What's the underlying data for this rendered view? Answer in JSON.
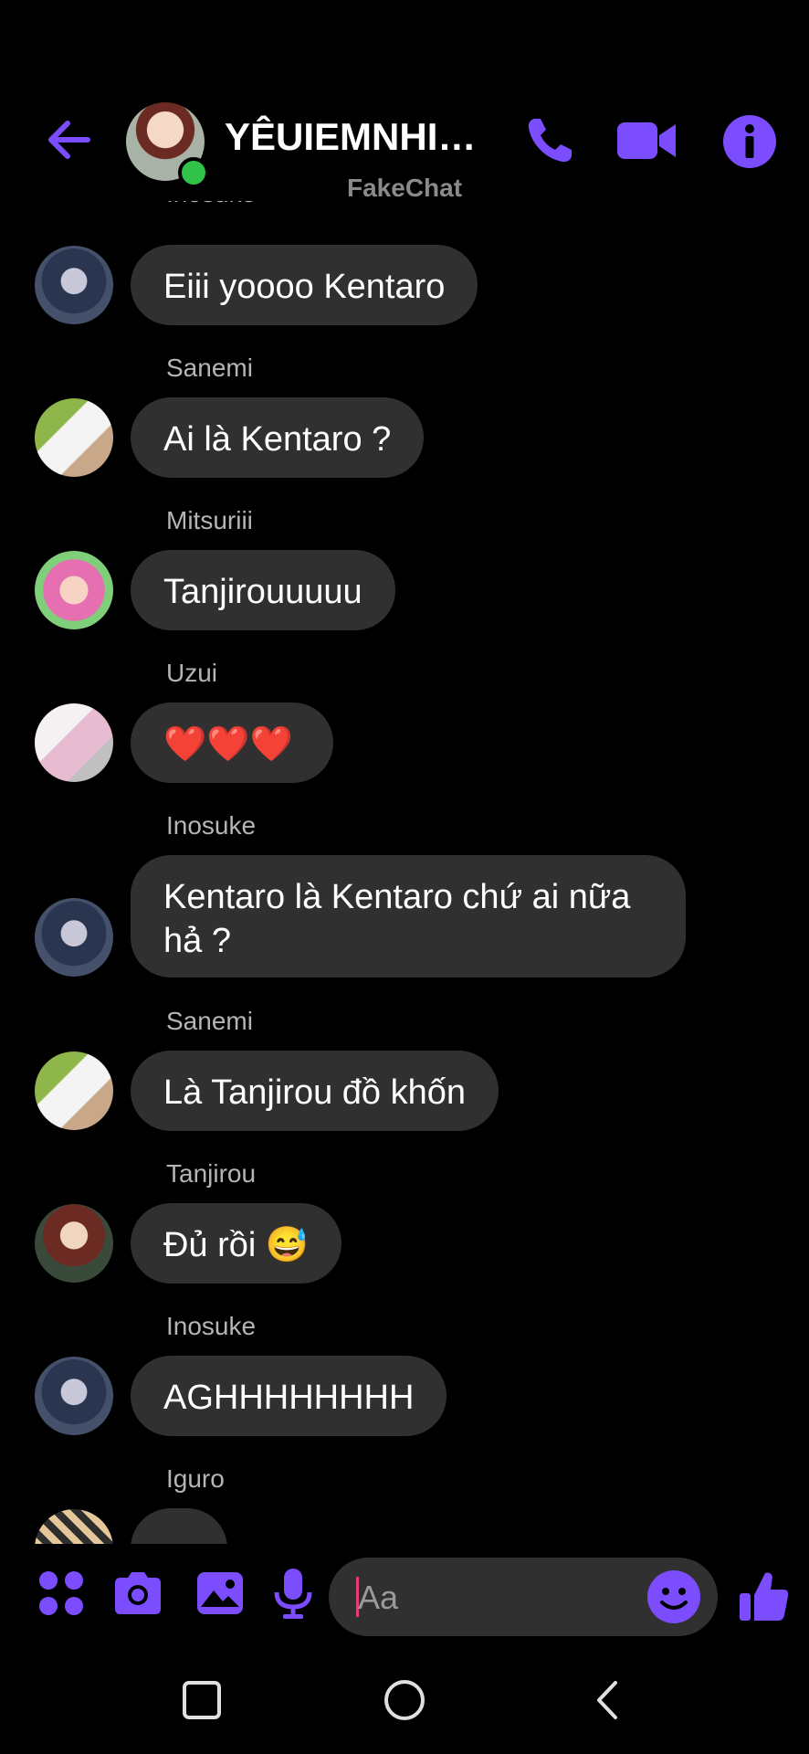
{
  "header": {
    "title": "YÊUIEMNHIEU...",
    "watermark": "FakeChat"
  },
  "messages": [
    {
      "sender": "Inosuke",
      "text": "Eiii yoooo Kentaro",
      "avatar": "inosuke-avatar"
    },
    {
      "sender": "Sanemi",
      "text": "Ai là Kentaro ?",
      "avatar": "sanemi-avatar"
    },
    {
      "sender": "Mitsuriii",
      "text": "Tanjirouuuuu",
      "avatar": "mitsuri-avatar"
    },
    {
      "sender": "Uzui",
      "text": "❤️❤️❤️",
      "avatar": "uzui-avatar"
    },
    {
      "sender": "Inosuke",
      "text_line1": "Kentaro là Kentaro chứ ai nữa",
      "text_line2": "hả ?",
      "avatar": "inosuke-avatar"
    },
    {
      "sender": "Sanemi",
      "text": "Là Tanjirou đồ khốn",
      "avatar": "sanemi-avatar"
    },
    {
      "sender": "Tanjirou",
      "text": "Đủ rồi 😅",
      "avatar": "tanjirou-avatar"
    },
    {
      "sender": "Inosuke",
      "text": "AGHHHHHHHH",
      "avatar": "inosuke-avatar"
    },
    {
      "sender": "Iguro",
      "text": "",
      "avatar": "iguro-avatar"
    }
  ],
  "composer": {
    "placeholder": "Aa"
  },
  "colors": {
    "accent": "#7b4dff",
    "bubble": "#303030",
    "online": "#31c24a",
    "background": "#000000"
  },
  "icons": [
    "back-arrow-icon",
    "phone-icon",
    "video-call-icon",
    "info-icon",
    "apps-grid-icon",
    "camera-icon",
    "gallery-icon",
    "microphone-icon",
    "emoji-icon",
    "thumbs-up-icon",
    "nav-recents-icon",
    "nav-home-icon",
    "nav-back-icon"
  ]
}
